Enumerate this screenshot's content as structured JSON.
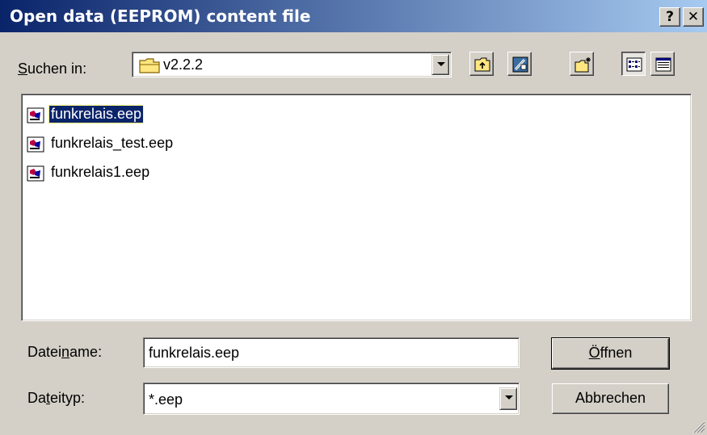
{
  "window": {
    "title": "Open data (EEPROM) content file",
    "help_label": "?",
    "close_label": "✕"
  },
  "lookin": {
    "label_pre": "",
    "label_accel": "S",
    "label_post": "uchen in:",
    "value": "v2.2.2",
    "folder_icon": "folder-icon"
  },
  "toolbar": [
    {
      "name": "up-one-level-button",
      "icon": "up-folder-icon"
    },
    {
      "name": "desktop-button",
      "icon": "desktop-icon"
    },
    {
      "name": "new-folder-button",
      "icon": "new-folder-icon"
    },
    {
      "name": "list-view-button",
      "icon": "list-view-icon",
      "pressed": true
    },
    {
      "name": "details-view-button",
      "icon": "details-view-icon"
    }
  ],
  "files": [
    {
      "name": "funkrelais.eep",
      "selected": true
    },
    {
      "name": "funkrelais_test.eep",
      "selected": false
    },
    {
      "name": "funkrelais1.eep",
      "selected": false
    }
  ],
  "filename": {
    "label_pre": "Datei",
    "label_accel": "n",
    "label_post": "ame:",
    "value": "funkrelais.eep"
  },
  "filetype": {
    "label_pre": "Da",
    "label_accel": "t",
    "label_post": "eityp:",
    "value": "*.eep"
  },
  "buttons": {
    "open_pre": "",
    "open_accel": "Ö",
    "open_post": "ffnen",
    "cancel": "Abbrechen"
  },
  "colors": {
    "title_start": "#0a246a",
    "title_end": "#a6caf0",
    "face": "#d4d0c8",
    "selection": "#0a246a"
  }
}
